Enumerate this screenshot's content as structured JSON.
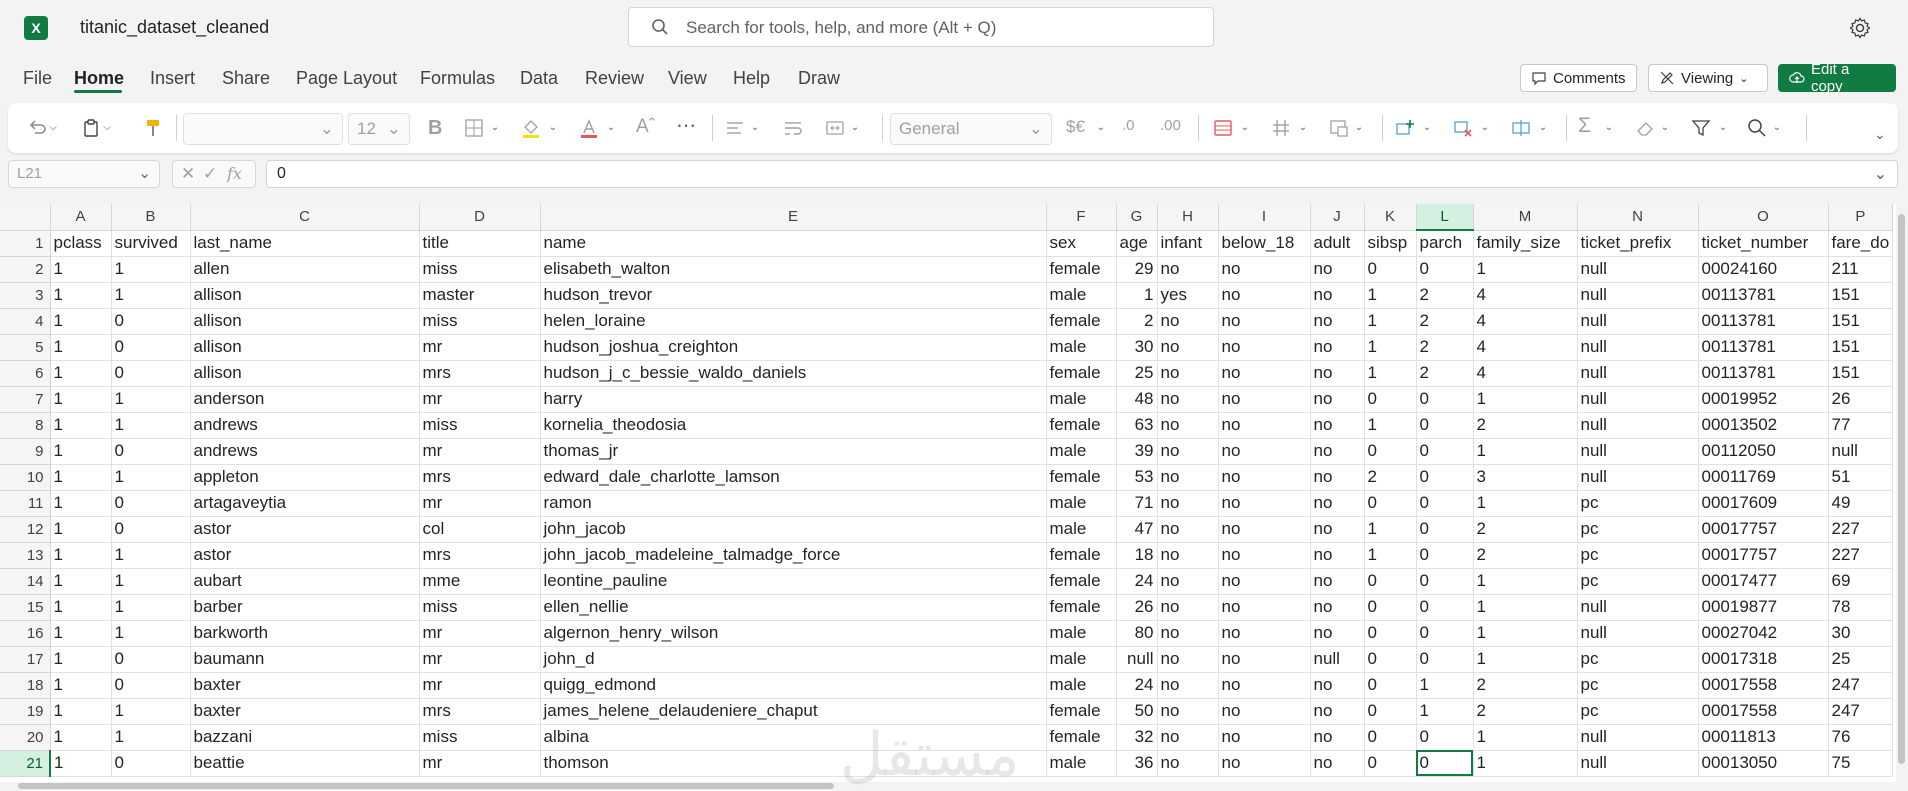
{
  "app": {
    "title": "titanic_dataset_cleaned",
    "logo_letter": "X",
    "brand_color": "#107c41"
  },
  "search": {
    "placeholder": "Search for tools, help, and more (Alt + Q)"
  },
  "menu": {
    "tabs": [
      "File",
      "Home",
      "Insert",
      "Share",
      "Page Layout",
      "Formulas",
      "Data",
      "Review",
      "View",
      "Help",
      "Draw"
    ],
    "active": "Home"
  },
  "header_buttons": {
    "comments": "Comments",
    "viewing": "Viewing",
    "edit": "Edit a copy"
  },
  "ribbon": {
    "font_name": "",
    "font_size": "12",
    "number_format": "General",
    "currency_symbol": "$€",
    "bold": "B"
  },
  "formula_bar": {
    "cell_ref": "L21",
    "value": "0",
    "fx": "fx"
  },
  "sheet": {
    "active_cell": "L21",
    "col_letters": [
      "A",
      "B",
      "C",
      "D",
      "E",
      "F",
      "G",
      "H",
      "I",
      "J",
      "K",
      "L",
      "M",
      "N",
      "O",
      "P"
    ],
    "rows": [
      [
        "pclass",
        "survived",
        "last_name",
        "title",
        "name",
        "sex",
        "age",
        "infant",
        "below_18",
        "adult",
        "sibsp",
        "parch",
        "family_size",
        "ticket_prefix",
        "ticket_number",
        "fare_do"
      ],
      [
        "1",
        "1",
        "allen",
        "miss",
        "elisabeth_walton",
        "female",
        "29",
        "no",
        "no",
        "no",
        "0",
        "0",
        "1",
        "null",
        "00024160",
        "211"
      ],
      [
        "1",
        "1",
        "allison",
        "master",
        "hudson_trevor",
        "male",
        "1",
        "yes",
        "no",
        "no",
        "1",
        "2",
        "4",
        "null",
        "00113781",
        "151"
      ],
      [
        "1",
        "0",
        "allison",
        "miss",
        "helen_loraine",
        "female",
        "2",
        "no",
        "no",
        "no",
        "1",
        "2",
        "4",
        "null",
        "00113781",
        "151"
      ],
      [
        "1",
        "0",
        "allison",
        "mr",
        "hudson_joshua_creighton",
        "male",
        "30",
        "no",
        "no",
        "no",
        "1",
        "2",
        "4",
        "null",
        "00113781",
        "151"
      ],
      [
        "1",
        "0",
        "allison",
        "mrs",
        "hudson_j_c_bessie_waldo_daniels",
        "female",
        "25",
        "no",
        "no",
        "no",
        "1",
        "2",
        "4",
        "null",
        "00113781",
        "151"
      ],
      [
        "1",
        "1",
        "anderson",
        "mr",
        "harry",
        "male",
        "48",
        "no",
        "no",
        "no",
        "0",
        "0",
        "1",
        "null",
        "00019952",
        "26"
      ],
      [
        "1",
        "1",
        "andrews",
        "miss",
        "kornelia_theodosia",
        "female",
        "63",
        "no",
        "no",
        "no",
        "1",
        "0",
        "2",
        "null",
        "00013502",
        "77"
      ],
      [
        "1",
        "0",
        "andrews",
        "mr",
        "thomas_jr",
        "male",
        "39",
        "no",
        "no",
        "no",
        "0",
        "0",
        "1",
        "null",
        "00112050",
        "null"
      ],
      [
        "1",
        "1",
        "appleton",
        "mrs",
        "edward_dale_charlotte_lamson",
        "female",
        "53",
        "no",
        "no",
        "no",
        "2",
        "0",
        "3",
        "null",
        "00011769",
        "51"
      ],
      [
        "1",
        "0",
        "artagaveytia",
        "mr",
        "ramon",
        "male",
        "71",
        "no",
        "no",
        "no",
        "0",
        "0",
        "1",
        "pc",
        "00017609",
        "49"
      ],
      [
        "1",
        "0",
        "astor",
        "col",
        "john_jacob",
        "male",
        "47",
        "no",
        "no",
        "no",
        "1",
        "0",
        "2",
        "pc",
        "00017757",
        "227"
      ],
      [
        "1",
        "1",
        "astor",
        "mrs",
        "john_jacob_madeleine_talmadge_force",
        "female",
        "18",
        "no",
        "no",
        "no",
        "1",
        "0",
        "2",
        "pc",
        "00017757",
        "227"
      ],
      [
        "1",
        "1",
        "aubart",
        "mme",
        "leontine_pauline",
        "female",
        "24",
        "no",
        "no",
        "no",
        "0",
        "0",
        "1",
        "pc",
        "00017477",
        "69"
      ],
      [
        "1",
        "1",
        "barber",
        "miss",
        "ellen_nellie",
        "female",
        "26",
        "no",
        "no",
        "no",
        "0",
        "0",
        "1",
        "null",
        "00019877",
        "78"
      ],
      [
        "1",
        "1",
        "barkworth",
        "mr",
        "algernon_henry_wilson",
        "male",
        "80",
        "no",
        "no",
        "no",
        "0",
        "0",
        "1",
        "null",
        "00027042",
        "30"
      ],
      [
        "1",
        "0",
        "baumann",
        "mr",
        "john_d",
        "male",
        "null",
        "no",
        "no",
        "null",
        "0",
        "0",
        "1",
        "pc",
        "00017318",
        "25"
      ],
      [
        "1",
        "0",
        "baxter",
        "mr",
        "quigg_edmond",
        "male",
        "24",
        "no",
        "no",
        "no",
        "0",
        "1",
        "2",
        "pc",
        "00017558",
        "247"
      ],
      [
        "1",
        "1",
        "baxter",
        "mrs",
        "james_helene_delaudeniere_chaput",
        "female",
        "50",
        "no",
        "no",
        "no",
        "0",
        "1",
        "2",
        "pc",
        "00017558",
        "247"
      ],
      [
        "1",
        "1",
        "bazzani",
        "miss",
        "albina",
        "female",
        "32",
        "no",
        "no",
        "no",
        "0",
        "0",
        "1",
        "null",
        "00011813",
        "76"
      ],
      [
        "1",
        "0",
        "beattie",
        "mr",
        "thomson",
        "male",
        "36",
        "no",
        "no",
        "no",
        "0",
        "0",
        "1",
        "null",
        "00013050",
        "75"
      ]
    ]
  },
  "watermark": "مستقل"
}
